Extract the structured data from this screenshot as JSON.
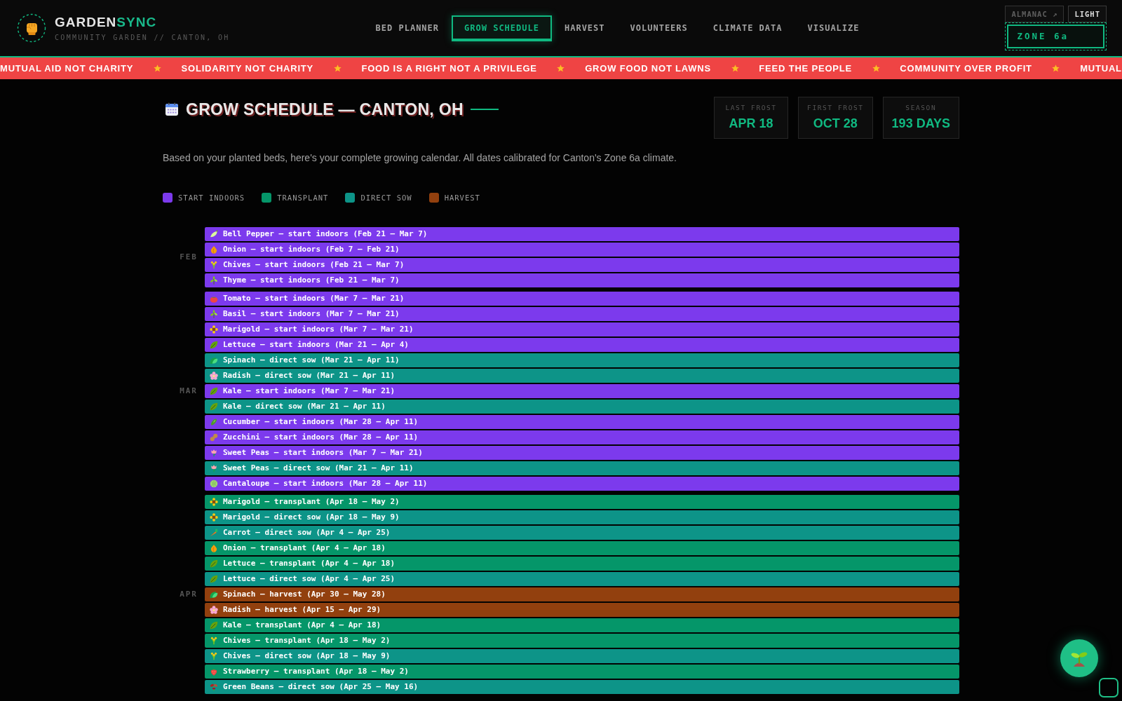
{
  "header": {
    "brand": {
      "name": "GARDEN",
      "name_accent": "SYNC",
      "tagline": "COMMUNITY GARDEN // CANTON, OH"
    },
    "nav": [
      {
        "label": "BED PLANNER",
        "selected": false
      },
      {
        "label": "GROW SCHEDULE",
        "selected": true
      },
      {
        "label": "HARVEST",
        "selected": false
      },
      {
        "label": "VOLUNTEERS",
        "selected": false
      },
      {
        "label": "CLIMATE DATA",
        "selected": false
      },
      {
        "label": "VISUALIZE",
        "selected": false
      }
    ],
    "actions": [
      {
        "kind": "link",
        "label": "ALMANAC ↗"
      },
      {
        "kind": "toggle",
        "label": "LIGHT"
      }
    ],
    "zone": "ZONE 6a"
  },
  "ticker": {
    "items": [
      "MUTUAL AID NOT CHARITY",
      "SOLIDARITY NOT CHARITY",
      "FOOD IS A RIGHT NOT A PRIVILEGE",
      "GROW FOOD NOT LAWNS",
      "FEED THE PEOPLE",
      "COMMUNITY OVER PROFIT",
      "MUTUAL"
    ]
  },
  "page": {
    "title": "GROW SCHEDULE — CANTON, OH",
    "stats": [
      {
        "label": "LAST FROST",
        "value": "APR 18"
      },
      {
        "label": "FIRST FROST",
        "value": "OCT 28"
      },
      {
        "label": "SEASON",
        "value": "193 DAYS"
      }
    ],
    "description": "Based on your planted beds, here's your complete growing calendar. All dates calibrated for Canton's Zone 6a climate.",
    "legend": [
      {
        "kind": "start_indoors",
        "label": "START INDOORS",
        "color": "#7c3aed"
      },
      {
        "kind": "transplant",
        "label": "TRANSPLANT",
        "color": "#059669"
      },
      {
        "kind": "direct_sow",
        "label": "DIRECT SOW",
        "color": "#0d9488"
      },
      {
        "kind": "harvest",
        "label": "HARVEST",
        "color": "#92400e"
      }
    ]
  },
  "schedule": {
    "months": [
      {
        "label": "FEB",
        "rows": [
          {
            "kind": "start_indoors",
            "label": "Bell Pepper — start indoors (Feb 21 — Mar 7)"
          },
          {
            "kind": "start_indoors",
            "label": "Onion — start indoors (Feb 7 — Feb 21)"
          },
          {
            "kind": "start_indoors",
            "label": "Chives — start indoors (Feb 21 — Mar 7)"
          },
          {
            "kind": "start_indoors",
            "label": "Thyme — start indoors (Feb 21 — Mar 7)"
          }
        ]
      },
      {
        "label": "MAR",
        "rows": [
          {
            "kind": "start_indoors",
            "label": "Tomato — start indoors (Mar 7 — Mar 21)"
          },
          {
            "kind": "start_indoors",
            "label": "Basil — start indoors (Mar 7 — Mar 21)"
          },
          {
            "kind": "start_indoors",
            "label": "Marigold — start indoors (Mar 7 — Mar 21)"
          },
          {
            "kind": "start_indoors",
            "label": "Lettuce — start indoors (Mar 21 — Apr 4)"
          },
          {
            "kind": "direct_sow",
            "label": "Spinach — direct sow (Mar 21 — Apr 11)"
          },
          {
            "kind": "direct_sow",
            "label": "Radish — direct sow (Mar 21 — Apr 11)"
          },
          {
            "kind": "start_indoors",
            "label": "Kale — start indoors (Mar 7 — Mar 21)"
          },
          {
            "kind": "direct_sow",
            "label": "Kale — direct sow (Mar 21 — Apr 11)"
          },
          {
            "kind": "start_indoors",
            "label": "Cucumber — start indoors (Mar 28 — Apr 11)"
          },
          {
            "kind": "start_indoors",
            "label": "Zucchini — start indoors (Mar 28 — Apr 11)"
          },
          {
            "kind": "start_indoors",
            "label": "Sweet Peas — start indoors (Mar 7 — Mar 21)"
          },
          {
            "kind": "direct_sow",
            "label": "Sweet Peas — direct sow (Mar 21 — Apr 11)"
          },
          {
            "kind": "start_indoors",
            "label": "Cantaloupe — start indoors (Mar 28 — Apr 11)"
          }
        ]
      },
      {
        "label": "APR",
        "rows": [
          {
            "kind": "transplant",
            "label": "Marigold — transplant (Apr 18 — May 2)"
          },
          {
            "kind": "direct_sow",
            "label": "Marigold — direct sow (Apr 18 — May 9)"
          },
          {
            "kind": "direct_sow",
            "label": "Carrot — direct sow (Apr 4 — Apr 25)"
          },
          {
            "kind": "transplant",
            "label": "Onion — transplant (Apr 4 — Apr 18)"
          },
          {
            "kind": "transplant",
            "label": "Lettuce — transplant (Apr 4 — Apr 18)"
          },
          {
            "kind": "direct_sow",
            "label": "Lettuce — direct sow (Apr 4 — Apr 25)"
          },
          {
            "kind": "harvest",
            "label": "Spinach — harvest (Apr 30 — May 28)"
          },
          {
            "kind": "harvest",
            "label": "Radish — harvest (Apr 15 — Apr 29)"
          },
          {
            "kind": "transplant",
            "label": "Kale — transplant (Apr 4 — Apr 18)"
          },
          {
            "kind": "transplant",
            "label": "Chives — transplant (Apr 18 — May 2)"
          },
          {
            "kind": "direct_sow",
            "label": "Chives — direct sow (Apr 18 — May 9)"
          },
          {
            "kind": "transplant",
            "label": "Strawberry — transplant (Apr 18 — May 2)"
          },
          {
            "kind": "direct_sow",
            "label": "Green Beans — direct sow (Apr 25 — May 16)"
          }
        ]
      }
    ]
  }
}
